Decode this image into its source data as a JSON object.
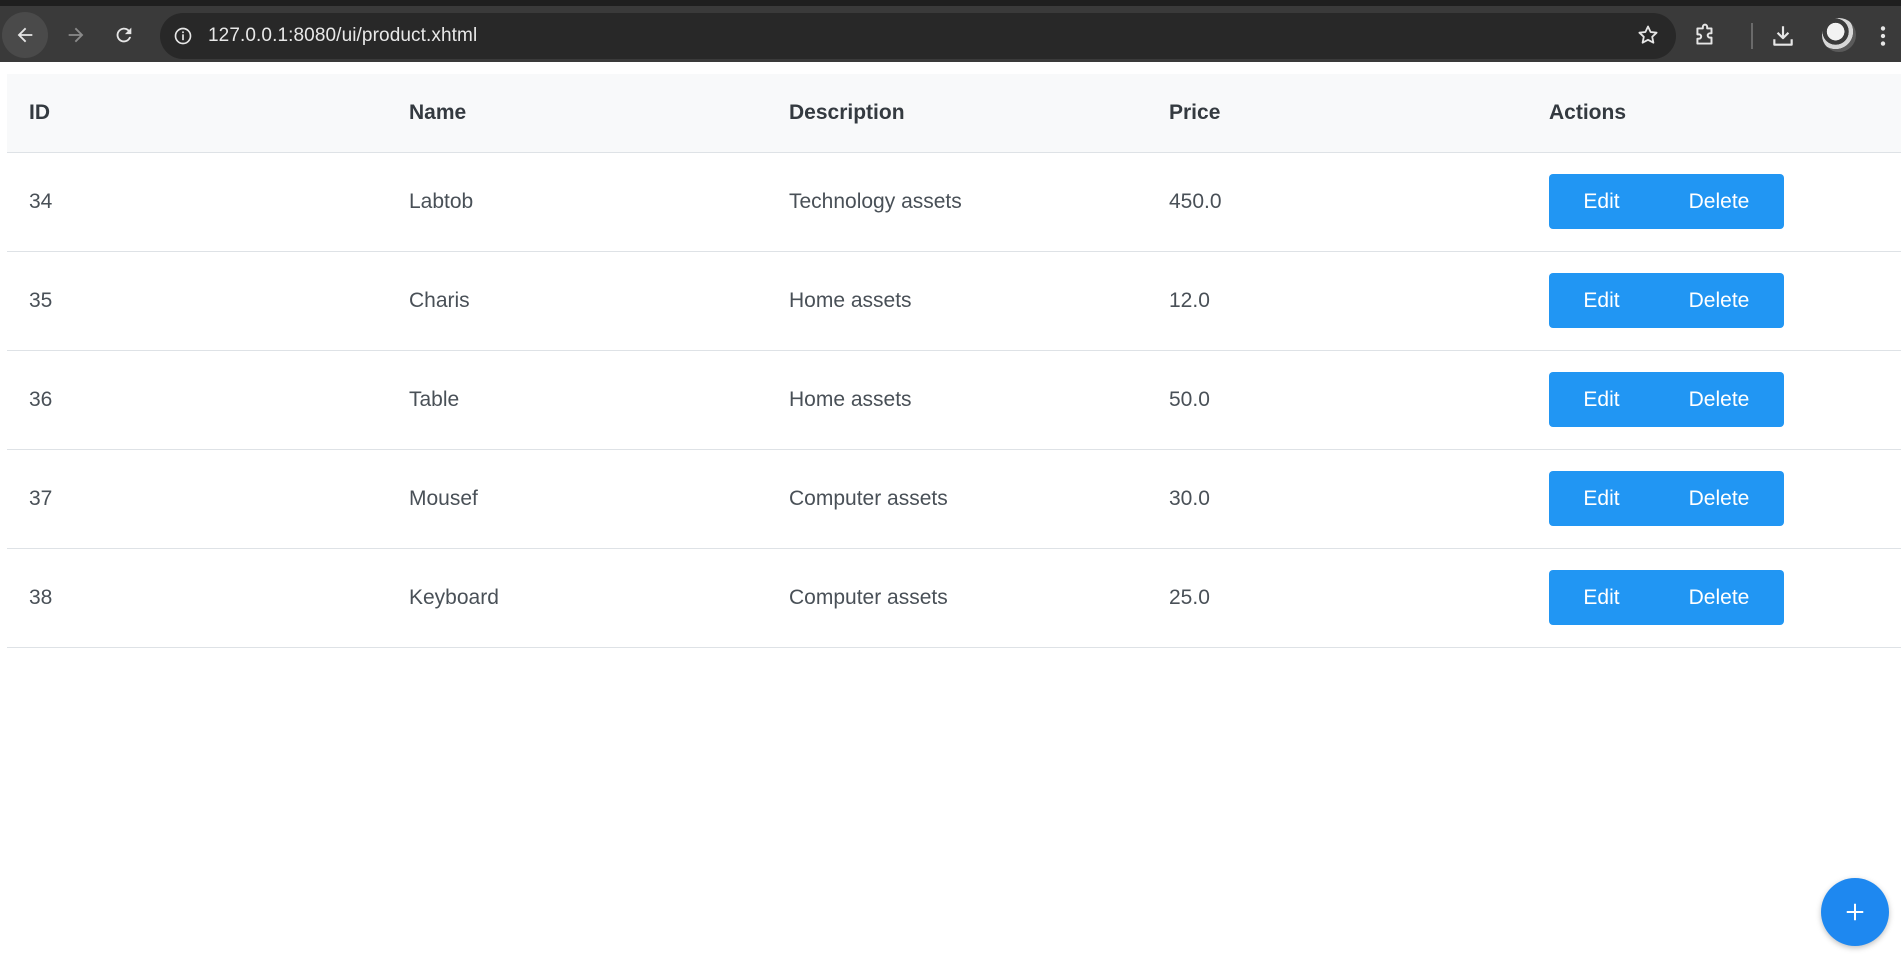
{
  "browser": {
    "url": "127.0.0.1:8080/ui/product.xhtml",
    "icons": {
      "back": "arrow-left-icon",
      "forward": "arrow-right-icon",
      "reload": "reload-icon",
      "site_info": "info-icon",
      "bookmark": "star-icon",
      "extensions": "puzzle-icon",
      "downloads": "download-icon",
      "menu": "more-vertical-icon"
    }
  },
  "table": {
    "headers": {
      "id": "ID",
      "name": "Name",
      "description": "Description",
      "price": "Price",
      "actions": "Actions"
    },
    "rows": [
      {
        "id": "34",
        "name": "Labtob",
        "description": "Technology assets",
        "price": "450.0",
        "edit": "Edit",
        "delete": "Delete"
      },
      {
        "id": "35",
        "name": "Charis",
        "description": "Home assets",
        "price": "12.0",
        "edit": "Edit",
        "delete": "Delete"
      },
      {
        "id": "36",
        "name": "Table",
        "description": "Home assets",
        "price": "50.0",
        "edit": "Edit",
        "delete": "Delete"
      },
      {
        "id": "37",
        "name": "Mousef",
        "description": "Computer assets",
        "price": "30.0",
        "edit": "Edit",
        "delete": "Delete"
      },
      {
        "id": "38",
        "name": "Keyboard",
        "description": "Computer assets",
        "price": "25.0",
        "edit": "Edit",
        "delete": "Delete"
      }
    ]
  },
  "fab": {
    "icon": "plus-icon"
  },
  "colors": {
    "accent": "#2196f3",
    "header_bg": "#f8f9fa",
    "chrome_bg": "#3a3a3a"
  }
}
